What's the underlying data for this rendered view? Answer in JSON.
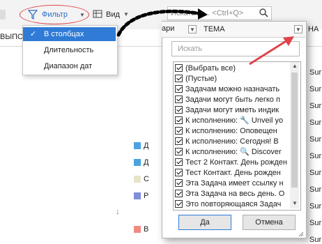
{
  "ribbon": {
    "filter_label": "Фильтр",
    "view_label": "Вид",
    "search_text": "Искать в ...   <Ctrl+Q>"
  },
  "columns": {
    "left_label": "ВЫПО...",
    "panel_left_label": "ари",
    "right_label": "НА"
  },
  "filter_menu": {
    "items": [
      {
        "label": "В столбцах",
        "selected": true
      },
      {
        "label": "Длительность",
        "selected": false
      },
      {
        "label": "Диапазон дат",
        "selected": false
      }
    ]
  },
  "left_markers": [
    {
      "letter": "Д",
      "color": "#4aa3e0"
    },
    {
      "letter": "Д",
      "color": "#4aa3e0"
    },
    {
      "letter": "С",
      "color": "#e8e4c8"
    },
    {
      "letter": "Р",
      "color": "#7f8fd8"
    },
    {
      "letter": "В",
      "color": "#f08b80"
    }
  ],
  "down_arrow": "↓",
  "panel": {
    "header_field": "ТЕМА",
    "search_placeholder": "Искать",
    "items": [
      "(Выбрать все)",
      "(Пустые)",
      "Задачам можно назначать",
      "Задачи могут быть легко п",
      "Задачи могут иметь индик",
      "К исполнению: 🔧 Unveil yo",
      "К исполнению: Оповещен",
      "К исполнению: Сегодня! В",
      "К исполнению: 🔍 Discover",
      "Тест 2 Контакт. День рожден",
      "Тест Контакт. День рожден",
      "Эта Задача имеет ссылку н",
      "Эта Задача на весь день. О",
      "Это повторяющаяся Задач"
    ],
    "ok_label": "Да",
    "cancel_label": "Отмена"
  },
  "right_column": [
    "Sur",
    "Sur",
    "Sur",
    "Sur",
    "Sur",
    "Sur",
    "Sur",
    "Sur",
    "Sur",
    "Sur",
    "Sur",
    "Sur"
  ]
}
